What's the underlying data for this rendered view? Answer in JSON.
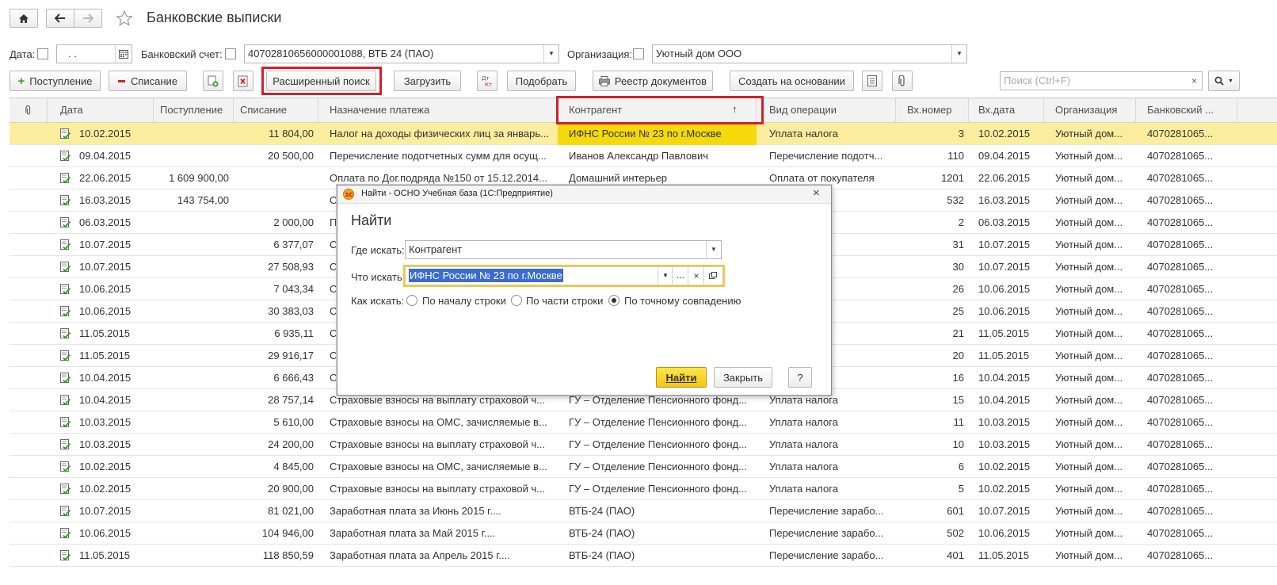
{
  "window": {
    "title": "Банковские выписки"
  },
  "filters": {
    "date_label": "Дата:",
    "date_value": " .  .",
    "account_label": "Банковский счет:",
    "account_value": "40702810656000001088, ВТБ 24 (ПАО)",
    "org_label": "Организация:",
    "org_value": "Уютный дом ООО"
  },
  "toolbar": {
    "income": "Поступление",
    "expense": "Списание",
    "advanced_search": "Расширенный поиск",
    "load": "Загрузить",
    "select": "Подобрать",
    "registry": "Реестр документов",
    "create_based": "Создать на основании",
    "search_placeholder": "Поиск (Ctrl+F)"
  },
  "columns": [
    "Дата",
    "Поступление",
    "Списание",
    "Назначение платежа",
    "Контрагент",
    "Вид операции",
    "Вх.номер",
    "Вх.дата",
    "Организация",
    "Банковский ..."
  ],
  "sort_indicator": "↑",
  "rows": [
    [
      "10.02.2015",
      "",
      "11 804,00",
      "Налог на доходы физических лиц за январь...",
      "ИФНС России № 23 по г.Москве",
      "Уплата налога",
      "3",
      "10.02.2015",
      "Уютный дом...",
      "4070281065..."
    ],
    [
      "09.04.2015",
      "",
      "20 500,00",
      "Перечисление подотчетных сумм для осущ...",
      "Иванов Александр Павлович",
      "Перечисление подотч...",
      "110",
      "09.04.2015",
      "Уютный дом...",
      "4070281065..."
    ],
    [
      "22.06.2015",
      "1 609 900,00",
      "",
      "Оплата по Дог.подряда №150 от 15.12.2014...",
      "Домашний интерьер",
      "Оплата от покупателя",
      "1201",
      "22.06.2015",
      "Уютный дом...",
      "4070281065..."
    ],
    [
      "16.03.2015",
      "143 754,00",
      "",
      "О",
      "",
      "покупателя",
      "532",
      "16.03.2015",
      "Уютный дом...",
      "4070281065..."
    ],
    [
      "06.03.2015",
      "",
      "2 000,00",
      "П",
      "",
      "ога",
      "2",
      "06.03.2015",
      "Уютный дом...",
      "4070281065..."
    ],
    [
      "10.07.2015",
      "",
      "6 377,07",
      "С",
      "",
      "ога",
      "31",
      "10.07.2015",
      "Уютный дом...",
      "4070281065..."
    ],
    [
      "10.07.2015",
      "",
      "27 508,93",
      "С",
      "",
      "ога",
      "30",
      "10.07.2015",
      "Уютный дом...",
      "4070281065..."
    ],
    [
      "10.06.2015",
      "",
      "7 043,34",
      "С",
      "",
      "ога",
      "26",
      "10.06.2015",
      "Уютный дом...",
      "4070281065..."
    ],
    [
      "10.06.2015",
      "",
      "30 383,03",
      "С",
      "",
      "ога",
      "25",
      "10.06.2015",
      "Уютный дом...",
      "4070281065..."
    ],
    [
      "11.05.2015",
      "",
      "6 935,11",
      "С",
      "",
      "ога",
      "21",
      "11.05.2015",
      "Уютный дом...",
      "4070281065..."
    ],
    [
      "11.05.2015",
      "",
      "29 916,17",
      "С",
      "",
      "ога",
      "20",
      "11.05.2015",
      "Уютный дом...",
      "4070281065..."
    ],
    [
      "10.04.2015",
      "",
      "6 666,43",
      "С",
      "",
      "ога",
      "16",
      "10.04.2015",
      "Уютный дом...",
      "4070281065..."
    ],
    [
      "10.04.2015",
      "",
      "28 757,14",
      "Страховые взносы на выплату страховой ч...",
      "ГУ – Отделение Пенсионного фонд...",
      "Уплата налога",
      "15",
      "10.04.2015",
      "Уютный дом...",
      "4070281065..."
    ],
    [
      "10.03.2015",
      "",
      "5 610,00",
      "Страховые взносы на ОМС, зачисляемые в...",
      "ГУ – Отделение Пенсионного фонд...",
      "Уплата налога",
      "11",
      "10.03.2015",
      "Уютный дом...",
      "4070281065..."
    ],
    [
      "10.03.2015",
      "",
      "24 200,00",
      "Страховые взносы на выплату страховой ч...",
      "ГУ – Отделение Пенсионного фонд...",
      "Уплата налога",
      "10",
      "10.03.2015",
      "Уютный дом...",
      "4070281065..."
    ],
    [
      "10.02.2015",
      "",
      "4 845,00",
      "Страховые взносы на ОМС, зачисляемые в...",
      "ГУ – Отделение Пенсионного фонд...",
      "Уплата налога",
      "6",
      "10.02.2015",
      "Уютный дом...",
      "4070281065..."
    ],
    [
      "10.02.2015",
      "",
      "20 900,00",
      "Страховые взносы на выплату страховой ч...",
      "ГУ – Отделение Пенсионного фонд...",
      "Уплата налога",
      "5",
      "10.02.2015",
      "Уютный дом...",
      "4070281065..."
    ],
    [
      "10.07.2015",
      "",
      "81 021,00",
      "Заработная плата за Июнь 2015 г....",
      "ВТБ-24 (ПАО)",
      "Перечисление зарабо...",
      "601",
      "10.07.2015",
      "Уютный дом...",
      "4070281065..."
    ],
    [
      "10.06.2015",
      "",
      "104 946,00",
      "Заработная плата за Май 2015 г....",
      "ВТБ-24 (ПАО)",
      "Перечисление зарабо...",
      "502",
      "10.06.2015",
      "Уютный дом...",
      "4070281065..."
    ],
    [
      "11.05.2015",
      "",
      "118 850,59",
      "Заработная плата за Апрель 2015 г....",
      "ВТБ-24 (ПАО)",
      "Перечисление зарабо...",
      "401",
      "11.05.2015",
      "Уютный дом...",
      "4070281065..."
    ]
  ],
  "dialog": {
    "window_title": "Найти - ОСНО Учебная база  (1С:Предприятие)",
    "heading": "Найти",
    "where_label": "Где искать:",
    "where_value": "Контрагент",
    "what_label": "Что искать:",
    "what_value": "ИФНС России № 23 по г.Москве",
    "how_label": "Как искать:",
    "opt_start": "По началу строки",
    "opt_part": "По части строки",
    "opt_exact": "По точному совпадению",
    "find_button": "Найти",
    "close_button": "Закрыть",
    "help_button": "?"
  },
  "colors": {
    "selected_row": "#fbed9e",
    "highlight_cell": "#f5d90a",
    "find_button": "#f7d21a",
    "red_frame": "#d0202a"
  }
}
